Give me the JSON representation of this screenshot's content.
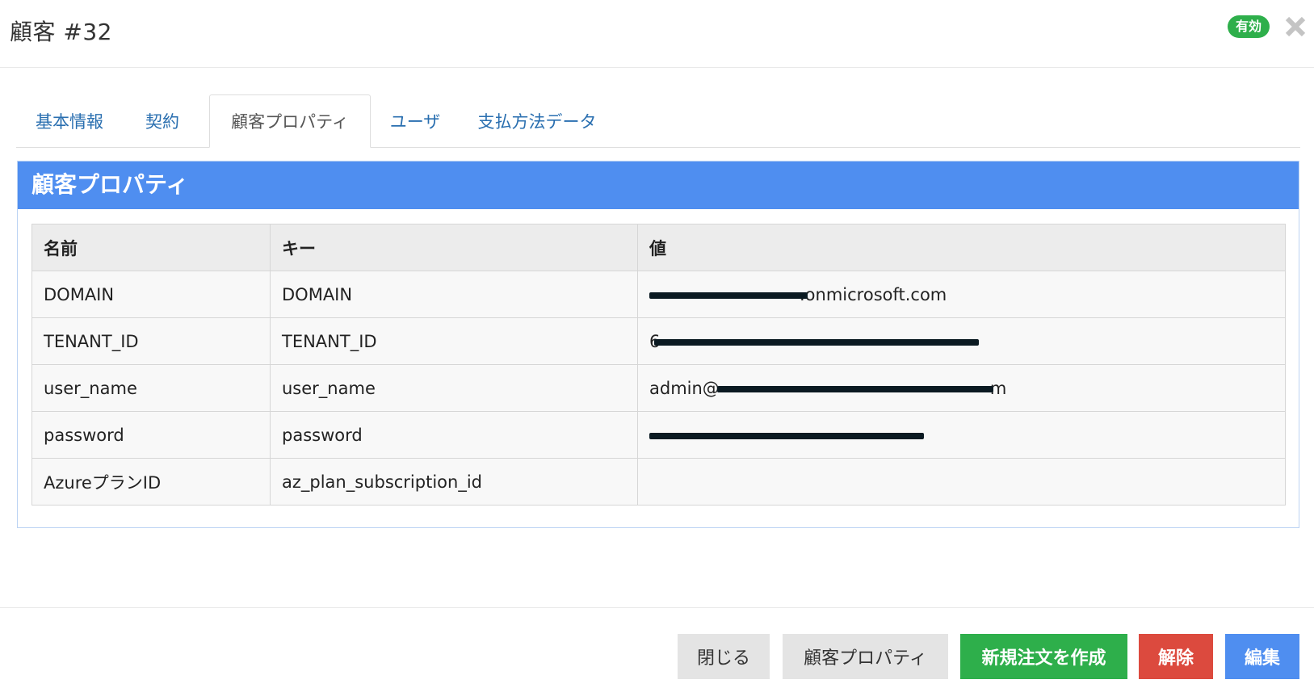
{
  "header": {
    "title": "顧客 #32",
    "status_badge": "有効"
  },
  "tabs": [
    {
      "label": "基本情報",
      "active": false
    },
    {
      "label": "契約",
      "active": false
    },
    {
      "label": "顧客プロパティ",
      "active": true
    },
    {
      "label": "ユーザ",
      "active": false
    },
    {
      "label": "支払方法データ",
      "active": false
    }
  ],
  "panel": {
    "title": "顧客プロパティ",
    "columns": [
      "名前",
      "キー",
      "値"
    ],
    "rows": [
      {
        "name": "DOMAIN",
        "key": "DOMAIN",
        "value_prefix": "",
        "value_suffix": ".onmicrosoft.com"
      },
      {
        "name": "TENANT_ID",
        "key": "TENANT_ID",
        "value_prefix": "6",
        "value_suffix": ""
      },
      {
        "name": "user_name",
        "key": "user_name",
        "value_prefix": "admin@",
        "value_suffix": "m"
      },
      {
        "name": "password",
        "key": "password",
        "value_prefix": "",
        "value_suffix": ""
      },
      {
        "name": "AzureプランID",
        "key": "az_plan_subscription_id",
        "value_prefix": "",
        "value_suffix": ""
      }
    ]
  },
  "footer": {
    "close_label": "閉じる",
    "properties_label": "顧客プロパティ",
    "new_order_label": "新規注文を作成",
    "cancel_label": "解除",
    "edit_label": "編集"
  },
  "colors": {
    "accent_blue": "#4f8ef0",
    "success_green": "#2eaf4b",
    "danger_red": "#dc4a3e",
    "link_blue": "#2a6fb0"
  }
}
